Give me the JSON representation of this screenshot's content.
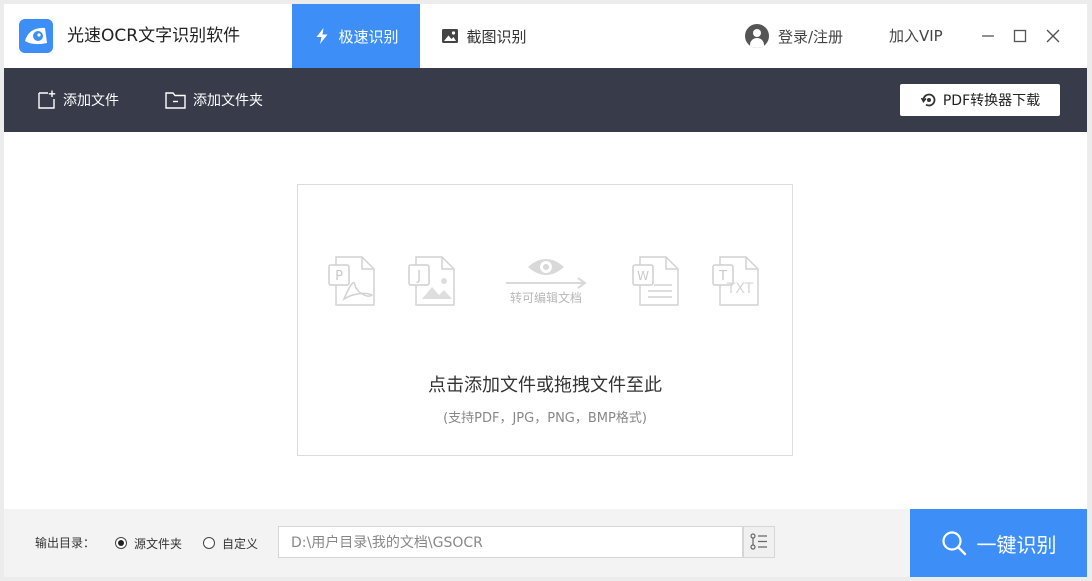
{
  "app": {
    "title": "光速OCR文字识别软件",
    "logo_icon": "eye-logo-icon",
    "accent": "#3d8ff7"
  },
  "tabs": [
    {
      "label": "极速识别",
      "icon": "lightning-icon",
      "active": true
    },
    {
      "label": "截图识别",
      "icon": "image-icon",
      "active": false
    }
  ],
  "header": {
    "login_label": "登录/注册",
    "vip_label": "加入VIP"
  },
  "window_controls": {
    "minimize": "minimize-icon",
    "maximize": "maximize-icon",
    "close": "close-icon"
  },
  "toolbar": {
    "add_file_label": "添加文件",
    "add_folder_label": "添加文件夹",
    "pdf_download_label": "PDF转换器下载",
    "background": "#373b4a"
  },
  "dropzone": {
    "convert_label": "转可编辑文档",
    "main_text": "点击添加文件或拖拽文件至此",
    "sub_text": "(支持PDF，JPG，PNG，BMP格式)",
    "file_types": [
      {
        "letter": "P",
        "icon": "pdf-file-icon"
      },
      {
        "letter": "J",
        "icon": "jpg-file-icon"
      },
      {
        "letter": "W",
        "icon": "word-file-icon"
      },
      {
        "letter": "T",
        "icon": "txt-file-icon",
        "text": "TXT"
      }
    ]
  },
  "bottom": {
    "output_label": "输出目录：",
    "radio_source_label": "源文件夹",
    "radio_custom_label": "自定义",
    "selected": "源文件夹",
    "path_value": "D:\\用户目录\\我的文档\\GSOCR",
    "recognize_label": "一键识别"
  }
}
